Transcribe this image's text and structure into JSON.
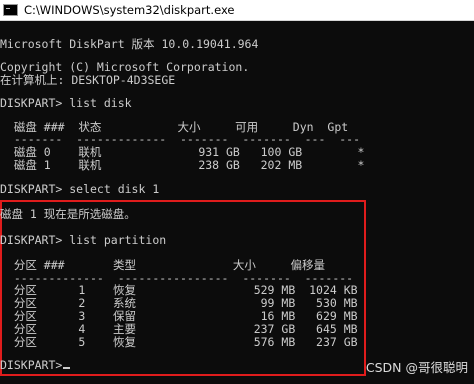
{
  "window": {
    "title": "C:\\WINDOWS\\system32\\diskpart.exe"
  },
  "console": {
    "version": "Microsoft DiskPart 版本 10.0.19041.964",
    "copyright": "Copyright (C) Microsoft Corporation.",
    "computer": "在计算机上: DESKTOP-4D3SEGE",
    "cmd1": "DISKPART> list disk",
    "disk_header": "  磁盘 ###  状态           大小     可用     Dyn  Gpt",
    "disk_sep": "  -------  -------------  -------  -------  ---  ---",
    "disk_row1": "  磁盘 0    联机              931 GB   100 GB        *",
    "disk_row2": "  磁盘 1    联机              238 GB   202 MB        *",
    "cmd2": "DISKPART> select disk 1",
    "select_msg": "磁盘 1 现在是所选磁盘。",
    "cmd3": "DISKPART> list partition",
    "part_header": "  分区 ###       类型              大小     偏移量",
    "part_sep": "  -------------  ----------------  -------  -------",
    "part_rows": [
      "  分区      1    恢复                 529 MB  1024 KB",
      "  分区      2    系统                  99 MB   530 MB",
      "  分区      3    保留                  16 MB   629 MB",
      "  分区      4    主要                 237 GB   645 MB",
      "  分区      5    恢复                 576 MB   237 GB"
    ],
    "prompt": "DISKPART> "
  },
  "watermark": "CSDN @哥很聪明",
  "colors": {
    "background": "#0c0c0c",
    "text": "#cccccc",
    "highlight_border": "#e01c1c"
  }
}
